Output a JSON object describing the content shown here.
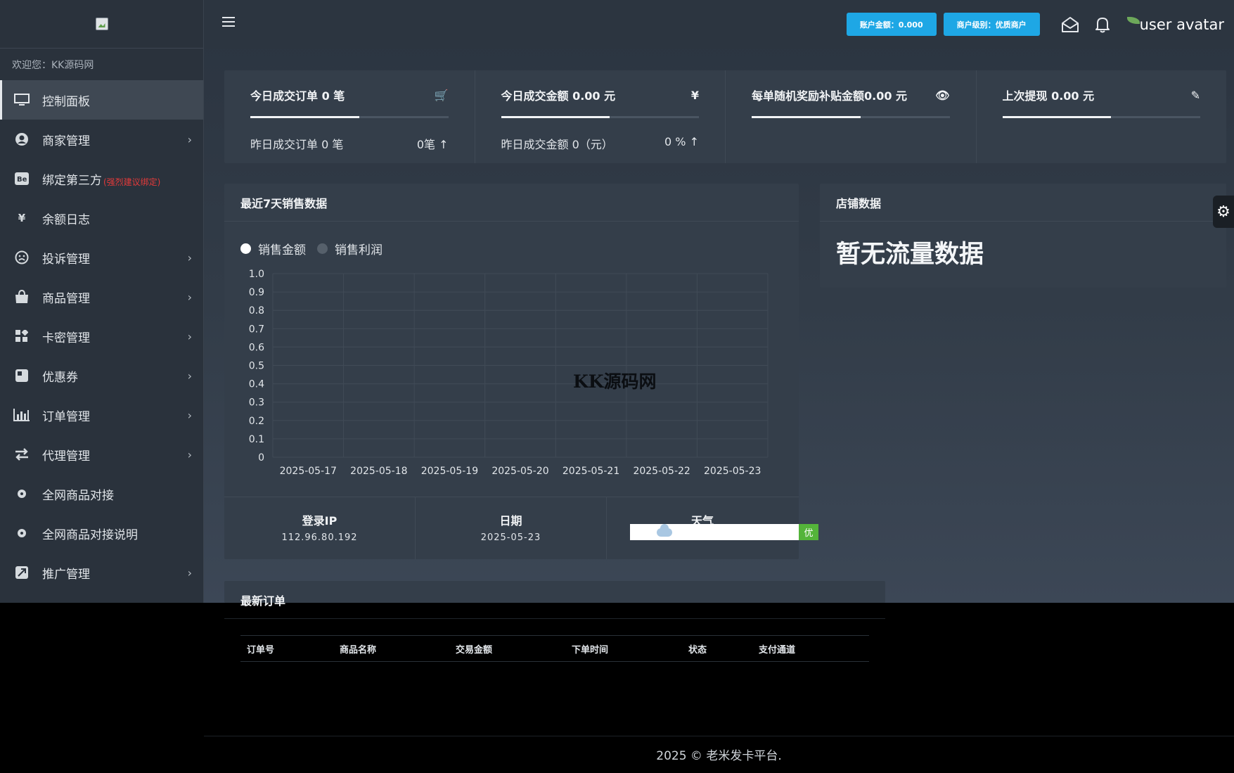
{
  "sidebar": {
    "welcome": "欢迎您：KK源码网",
    "items": [
      {
        "label": "控制面板",
        "icon": "monitor-icon",
        "active": true,
        "chevron": false
      },
      {
        "label": "商家管理",
        "icon": "user-circle-icon",
        "chevron": true
      },
      {
        "label": "绑定第三方",
        "icon": "behance-icon",
        "chevron": false,
        "hint": "(强烈建议绑定)"
      },
      {
        "label": "余额日志",
        "icon": "yen-icon",
        "chevron": false
      },
      {
        "label": "投诉管理",
        "icon": "frown-icon",
        "chevron": true
      },
      {
        "label": "商品管理",
        "icon": "shopping-bag-icon",
        "chevron": true
      },
      {
        "label": "卡密管理",
        "icon": "grid-icon",
        "chevron": true
      },
      {
        "label": "优惠券",
        "icon": "coupon-icon",
        "chevron": true
      },
      {
        "label": "订单管理",
        "icon": "bar-chart-icon",
        "chevron": true
      },
      {
        "label": "代理管理",
        "icon": "exchange-icon",
        "chevron": true
      },
      {
        "label": "全网商品对接",
        "icon": "dot-circle-icon",
        "chevron": false
      },
      {
        "label": "全网商品对接说明",
        "icon": "dot-circle-icon",
        "chevron": false
      },
      {
        "label": "推广管理",
        "icon": "promote-icon",
        "chevron": true
      }
    ]
  },
  "topbar": {
    "balance": "账户金额：0.000",
    "level": "商户级别：优质商户",
    "avatar_alt": "user avatar",
    "accent": "#1ea7e5"
  },
  "stats": [
    {
      "title": "今日成交订单 0 笔",
      "icon": "cart-icon",
      "glyph": "🛒",
      "progress": 0.55,
      "sub_left": "昨日成交订单 0 笔",
      "sub_right": "0笔 ↑"
    },
    {
      "title": "今日成交金额 0.00 元",
      "icon": "yen-icon",
      "glyph": "¥",
      "progress": 0.55,
      "sub_left": "昨日成交金额 0（元）",
      "sub_right": "0 % ↑"
    },
    {
      "title": "每单随机奖励补贴金额0.00 元",
      "icon": "eye-icon",
      "glyph": "👁",
      "progress": 0.55,
      "sub_left": "",
      "sub_right": ""
    },
    {
      "title": "上次提现 0.00 元",
      "icon": "leaf-icon",
      "glyph": "✎",
      "progress": 0.55,
      "sub_left": "",
      "sub_right": ""
    }
  ],
  "sales_panel": {
    "title": "最近7天销售数据",
    "legend": [
      {
        "label": "销售金额",
        "color": "#ffffff"
      },
      {
        "label": "销售利润",
        "color": "#56606b"
      }
    ],
    "watermark": "KK源码网"
  },
  "chart_data": {
    "type": "line",
    "categories": [
      "2025-05-17",
      "2025-05-18",
      "2025-05-19",
      "2025-05-20",
      "2025-05-21",
      "2025-05-22",
      "2025-05-23"
    ],
    "series": [
      {
        "name": "销售金额",
        "values": [
          0,
          0,
          0,
          0,
          0,
          0,
          0
        ]
      },
      {
        "name": "销售利润",
        "values": [
          0,
          0,
          0,
          0,
          0,
          0,
          0
        ]
      }
    ],
    "yticks": [
      "0",
      "0.1",
      "0.2",
      "0.3",
      "0.4",
      "0.5",
      "0.6",
      "0.7",
      "0.8",
      "0.9",
      "1.0"
    ],
    "ylim": [
      0,
      1
    ],
    "grid": true
  },
  "info": {
    "ip_label": "登录IP",
    "ip_value": "112.96.80.192",
    "date_label": "日期",
    "date_value": "2025-05-23",
    "weather_label": "天气",
    "aqi": "优"
  },
  "shop_panel": {
    "title": "店铺数据",
    "message": "暂无流量数据"
  },
  "orders": {
    "title": "最新订单",
    "columns": [
      "订单号",
      "商品名称",
      "交易金额",
      "下单时间",
      "状态",
      "支付通道"
    ]
  },
  "footer": "2025 © 老米发卡平台."
}
